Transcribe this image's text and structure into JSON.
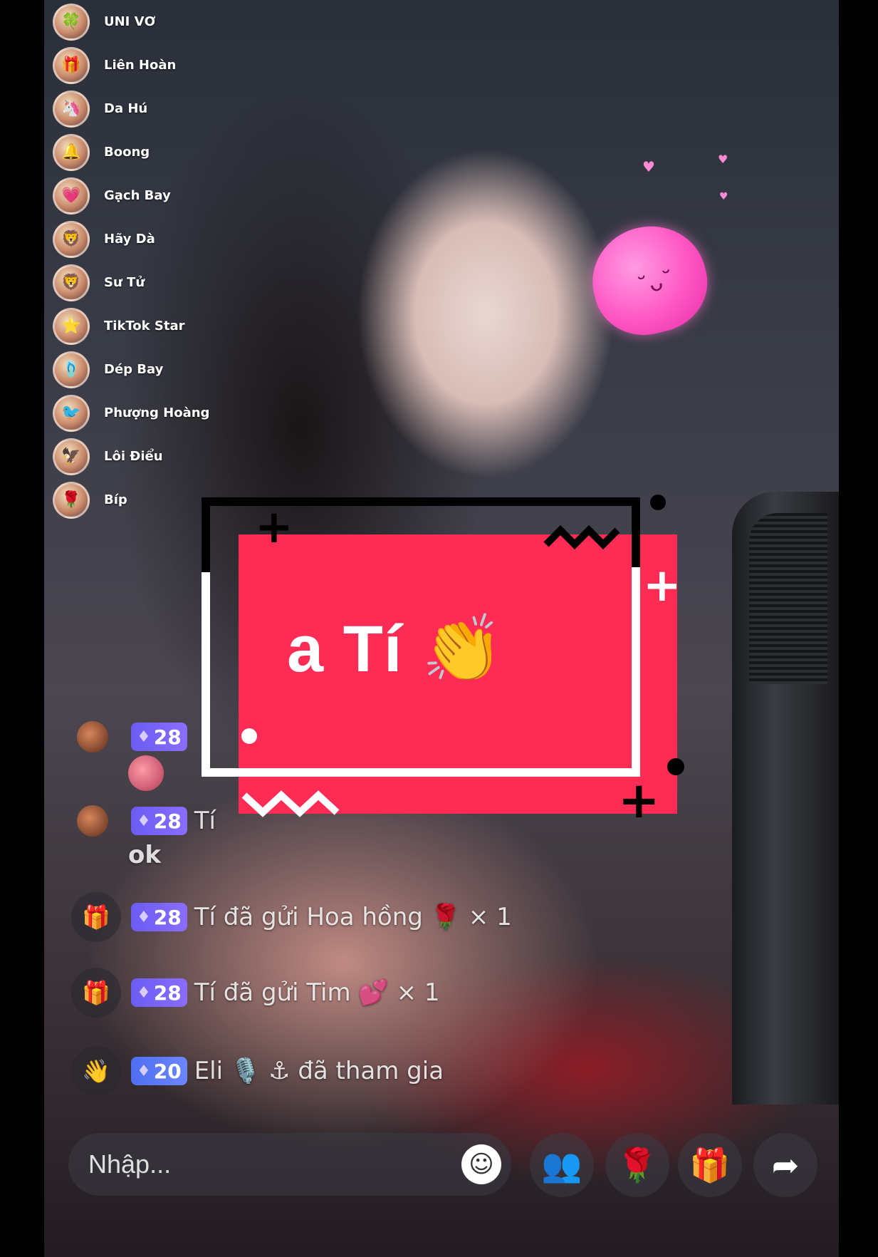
{
  "gift_list": [
    {
      "name": "UNI VƠ",
      "icon": "clover-gift-icon",
      "glyph": "🍀"
    },
    {
      "name": "Liên Hoàn",
      "icon": "gift-icon",
      "glyph": "🎁"
    },
    {
      "name": "Da Hú",
      "icon": "gift-icon",
      "glyph": "🦄"
    },
    {
      "name": "Boong",
      "icon": "gift-icon",
      "glyph": "🔔"
    },
    {
      "name": "Gạch Bay",
      "icon": "gift-icon",
      "glyph": "💗"
    },
    {
      "name": "Hãy Dà",
      "icon": "gift-icon",
      "glyph": "🦁"
    },
    {
      "name": "Sư Tử",
      "icon": "lion-icon",
      "glyph": "🦁"
    },
    {
      "name": "TikTok Star",
      "icon": "star-icon",
      "glyph": "⭐"
    },
    {
      "name": "Dép Bay",
      "icon": "slipper-icon",
      "glyph": "🩴"
    },
    {
      "name": "Phượng Hoàng",
      "icon": "phoenix-icon",
      "glyph": "🐦"
    },
    {
      "name": "Lôi Điểu",
      "icon": "thunderbird-icon",
      "glyph": "🦅"
    },
    {
      "name": "Bíp",
      "icon": "gift-icon",
      "glyph": "🌹"
    }
  ],
  "highlight": {
    "text": "a Tí 👏"
  },
  "chat": [
    {
      "badge": "28",
      "text": "",
      "extra": ""
    },
    {
      "badge": "28",
      "text": "Tí",
      "extra": "ok"
    },
    {
      "badge": "28",
      "text": "Tí đã gửi Hoa hồng 🌹 × 1",
      "icon": "gift-box-icon"
    },
    {
      "badge": "28",
      "text": "Tí đã gửi Tim 💕 × 1",
      "icon": "gift-box-icon"
    },
    {
      "badge": "20",
      "text": "Eli 🎙️ ⚓ đã tham gia",
      "icon": "waving-hand-icon"
    }
  ],
  "input": {
    "placeholder": "Nhập..."
  },
  "colors": {
    "accent": "#fe2c55",
    "badge": "#7b66f7"
  }
}
